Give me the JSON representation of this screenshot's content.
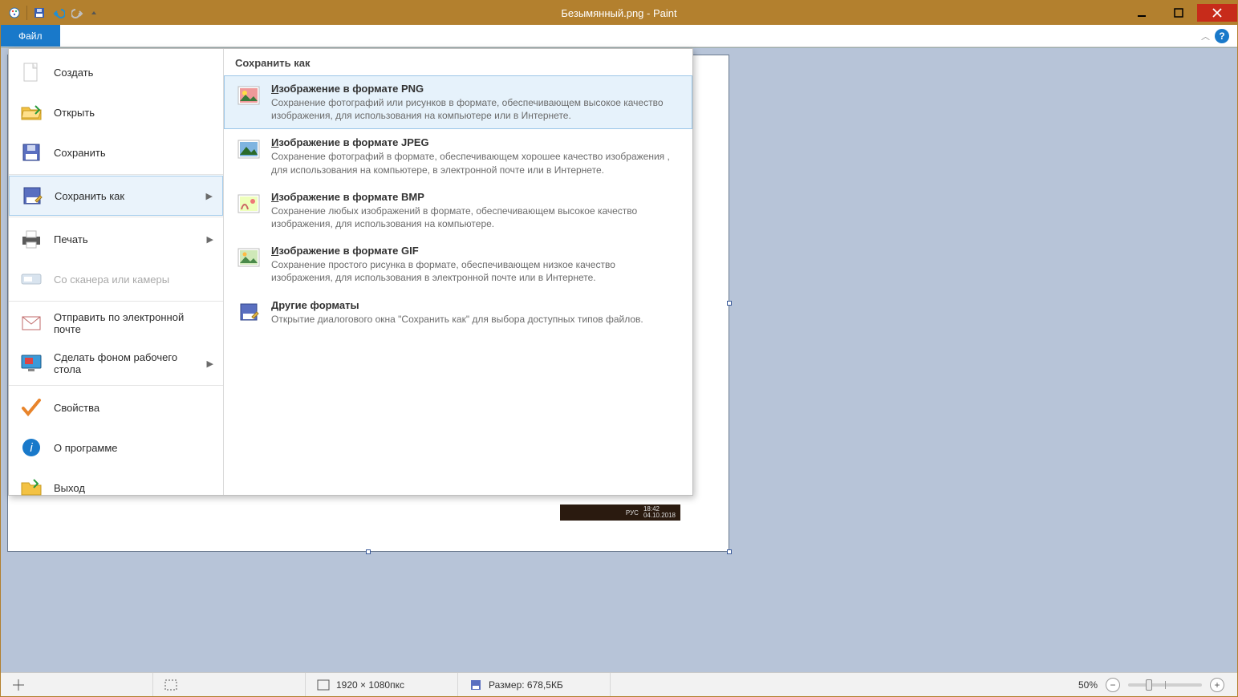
{
  "window": {
    "title": "Безымянный.png - Paint"
  },
  "ribbon": {
    "file_tab": "Файл"
  },
  "file_menu": {
    "items": [
      {
        "label": "Создать"
      },
      {
        "label": "Открыть"
      },
      {
        "label": "Сохранить"
      },
      {
        "label": "Сохранить как"
      },
      {
        "label": "Печать"
      },
      {
        "label": "Со сканера или камеры"
      },
      {
        "label": "Отправить по электронной почте"
      },
      {
        "label": "Сделать фоном рабочего стола"
      },
      {
        "label": "Свойства"
      },
      {
        "label": "О программе"
      },
      {
        "label": "Выход"
      }
    ],
    "submenu_header": "Сохранить как",
    "formats": [
      {
        "title": "Изображение в формате PNG",
        "desc": "Сохранение фотографий или рисунков в формате, обеспечивающем высокое качество изображения, для использования на компьютере или в Интернете."
      },
      {
        "title": "Изображение в формате JPEG",
        "desc": "Сохранение фотографий в формате, обеспечивающем хорошее качество изображения , для использования на компьютере, в электронной почте или в Интернете."
      },
      {
        "title": "Изображение в формате BMP",
        "desc": "Сохранение любых изображений в формате, обеспечивающем высокое качество изображения, для использования на компьютере."
      },
      {
        "title": "Изображение в формате GIF",
        "desc": "Сохранение простого рисунка в формате, обеспечивающем низкое качество изображения, для использования в электронной почте или в Интернете."
      },
      {
        "title": "Другие форматы",
        "desc": "Открытие диалогового окна \"Сохранить как\" для выбора доступных типов файлов."
      }
    ]
  },
  "canvas_tray": {
    "lang": "РУС",
    "time": "18:42",
    "date": "04.10.2018"
  },
  "statusbar": {
    "dimensions": "1920 × 1080пкс",
    "size_label": "Размер: 678,5КБ",
    "zoom": "50%"
  }
}
